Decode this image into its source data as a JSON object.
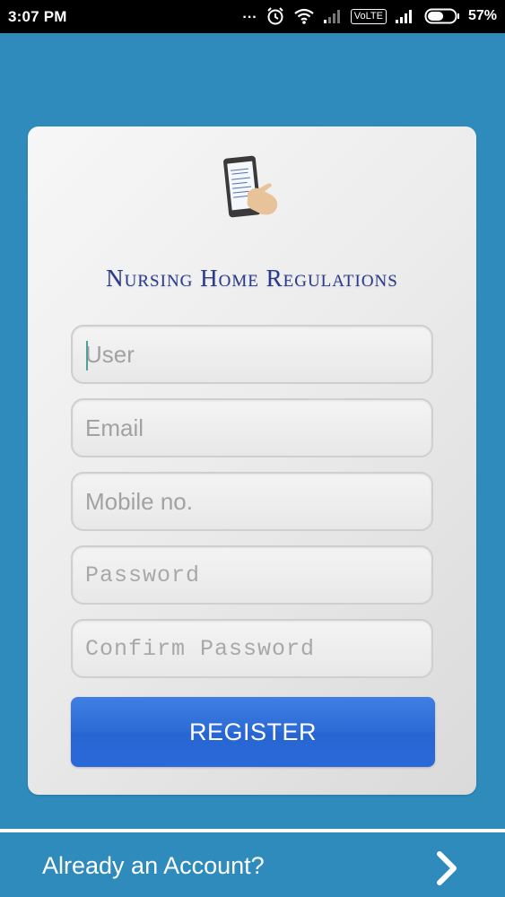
{
  "status_bar": {
    "time": "3:07 PM",
    "dots": "...",
    "network_label": "VoLTE",
    "battery_percent": "57%",
    "battery_level": 0.57,
    "icons": [
      "alarm-icon",
      "wifi-icon",
      "signal-icon",
      "signal-icon",
      "battery-icon"
    ]
  },
  "app": {
    "title": "Nursing Home Regulations",
    "logo_icon": "phone-document-logo-icon"
  },
  "form": {
    "user_placeholder": "User",
    "email_placeholder": "Email",
    "mobile_placeholder": "Mobile no.",
    "password_placeholder": "Password",
    "confirm_password_placeholder": "Confirm Password",
    "register_label": "REGISTER"
  },
  "footer": {
    "login_prompt": "Already an Account?",
    "arrow_icon": "chevron-right-icon"
  },
  "colors": {
    "background": "#2e8bbb",
    "title": "#2a3a8c",
    "register_button": "#2d6bd6",
    "status_bar": "#000000"
  }
}
